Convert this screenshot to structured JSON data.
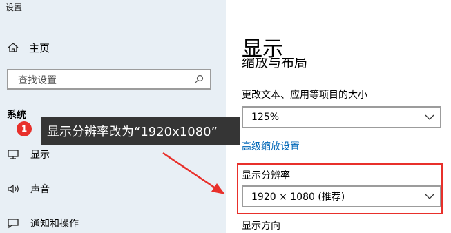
{
  "window": {
    "title": "设置"
  },
  "sidebar": {
    "home_label": "主页",
    "search_placeholder": "查找设置",
    "section_title": "系统",
    "items": [
      {
        "label": "显示",
        "icon": "monitor-icon"
      },
      {
        "label": "声音",
        "icon": "speaker-icon"
      },
      {
        "label": "通知和操作",
        "icon": "message-icon"
      }
    ]
  },
  "annotation": {
    "step_number": "1",
    "tooltip_text": "显示分辨率改为“1920x1080”",
    "color": "#e8302b"
  },
  "main": {
    "title": "显示",
    "partial_heading": "缩放与布局",
    "scale_label": "更改文本、应用等项目的大小",
    "scale_value": "125%",
    "advanced_link": "高级缩放设置",
    "resolution_label": "显示分辨率",
    "resolution_value": "1920 × 1080 (推荐)",
    "orientation_label": "显示方向"
  },
  "colors": {
    "sidebar_bg": "#e8eff5",
    "link": "#0067b8",
    "highlight": "#e8302b",
    "tooltip_bg": "#353535"
  }
}
